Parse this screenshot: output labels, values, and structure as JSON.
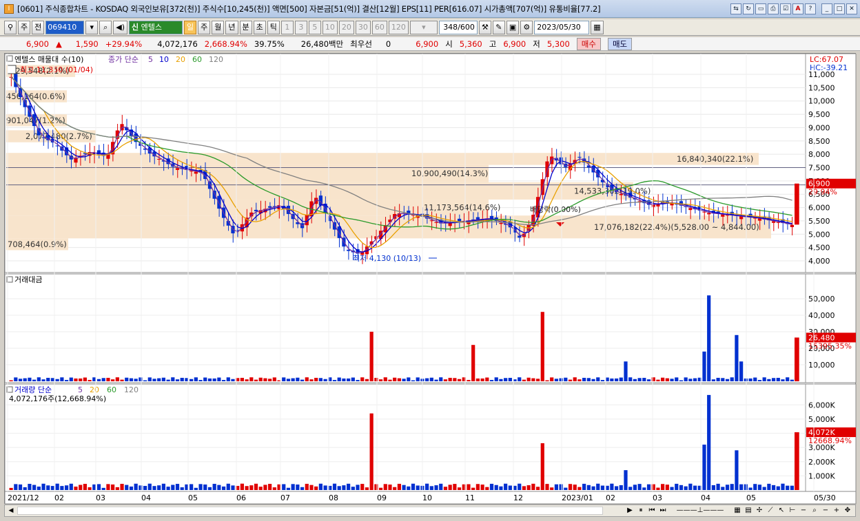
{
  "window": {
    "title": "[0601] 주식종합차트 - KOSDAQ 외국인보유[372(천)] 주식수[10,245(천)] 액면[500] 자본금[51(억)] 결산[12월] EPS[11] PER[616.07] 시가총액[707(억)] 유통비율[77.2]"
  },
  "toolbar": {
    "type": "주",
    "prev": "전",
    "code": "069410",
    "market_badge": "신",
    "name": "엔텔스",
    "period_buttons": [
      "일",
      "주",
      "월",
      "년",
      "분",
      "초",
      "틱"
    ],
    "interval_buttons": [
      "1",
      "3",
      "5",
      "10",
      "20",
      "30",
      "60",
      "120"
    ],
    "count": "348",
    "count_max": "/600",
    "date": "2023/05/30"
  },
  "quote": {
    "price": "6,900",
    "change": "1,590",
    "rate": "+29.94%",
    "volume": "4,072,176",
    "vol_rate": "2,668.94%",
    "turnover": "39.75%",
    "amount": "26,480백만",
    "prefer_label": "최우선",
    "prefer_value": "0",
    "ask": "6,900",
    "open_label": "시",
    "open": "5,360",
    "high_label": "고",
    "high": "6,900",
    "low_label": "저",
    "low": "5,300",
    "buy": "매수",
    "sell": "매도"
  },
  "colors": {
    "up": "#e00000",
    "down": "#0030d0",
    "ma5": "#7030a0",
    "ma10": "#0000cc",
    "ma20": "#e8a000",
    "ma60": "#2a9a2a",
    "ma120": "#808080",
    "band": "#f8e4cc"
  },
  "chart": {
    "price_title": "엔텔스 매물대 수(10)",
    "ma_label": "종가 단순",
    "ma_periods": [
      "5",
      "10",
      "20",
      "60",
      "120"
    ],
    "high_label": "최고 11,350 (01/04)",
    "low_label": "최저 4,130 (10/13)",
    "dividend_label": "배당락(0.00%)",
    "price_ticks": [
      "11,000",
      "10,500",
      "10,000",
      "9,500",
      "9,000",
      "8,500",
      "8,000",
      "7,500",
      "7,000",
      "6,500",
      "6,000",
      "5,500",
      "5,000",
      "4,500",
      "4,000"
    ],
    "lc": "LC:67.07",
    "hc": "HC:-39.21",
    "last_price": "6,900",
    "last_rate": "29.94%",
    "profile": [
      {
        "label": "829,548(2.1%)"
      },
      {
        "label": "456,164(0.6%)"
      },
      {
        "label": "901,047(1.2%)"
      },
      {
        "label": "2,077,480(2.7%)"
      },
      {
        "label": "16,840,340(22.1%)"
      },
      {
        "label": "10,900,490(14.3%)"
      },
      {
        "label": "14,533,302(19.0%)"
      },
      {
        "label": "11,173,564(14.6%)"
      },
      {
        "label": "17,076,182(22.4%)(5,528.00 ~ 4,844.00)"
      },
      {
        "label": "708,464(0.9%)"
      }
    ],
    "amount_title": "거래대금",
    "amount_ticks": [
      "50,000",
      "40,000",
      "30,000",
      "20,000",
      "10,000"
    ],
    "amount_last": "26,480",
    "amount_last_rate": "15395.35%",
    "volume_title": "거래량 단순",
    "volume_ma": [
      "5",
      "20",
      "60",
      "120"
    ],
    "volume_info": "4,072,176주(12,668.94%)",
    "volume_ticks": [
      "6,000K",
      "5,000K",
      "4,000K",
      "3,000K",
      "2,000K",
      "1,000K"
    ],
    "volume_last": "4,072K",
    "volume_last_rate": "12668.94%",
    "x_ticks": [
      "2021/12",
      "02",
      "03",
      "04",
      "05",
      "06",
      "07",
      "08",
      "09",
      "10",
      "11",
      "12",
      "2023/01",
      "02",
      "03",
      "04",
      "05",
      "05/30"
    ]
  }
}
